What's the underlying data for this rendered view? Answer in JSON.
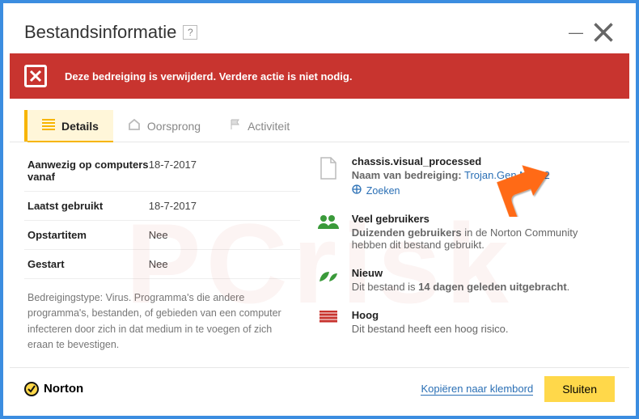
{
  "titlebar": {
    "title": "Bestandsinformatie"
  },
  "alert": {
    "text": "Deze bedreiging is verwijderd. Verdere actie is niet nodig."
  },
  "tabs": {
    "details": "Details",
    "origin": "Oorsprong",
    "activity": "Activiteit"
  },
  "rows": {
    "present_label": "Aanwezig op computers vanaf",
    "present_value": "18-7-2017",
    "lastused_label": "Laatst gebruikt",
    "lastused_value": "18-7-2017",
    "startup_label": "Opstartitem",
    "startup_value": "Nee",
    "started_label": "Gestart",
    "started_value": "Nee"
  },
  "description": "Bedreigingstype: Virus. Programma's die andere programma's, bestanden, of gebieden van een computer infecteren door zich in dat medium in te voegen of zich eraan te bevestigen.",
  "right": {
    "file_name": "chassis.visual_processed",
    "threat_label": "Naam van bedreiging:",
    "threat_name": "Trojan.Gen.NPE.2",
    "search": "Zoeken",
    "item2_h": "Veel gebruikers",
    "item2_s_pre": "Duizenden gebruikers",
    "item2_s_post": " in de Norton Community hebben dit bestand gebruikt.",
    "item3_h": "Nieuw",
    "item3_s_pre": "Dit bestand is ",
    "item3_s_bold": "14 dagen geleden uitgebracht",
    "item3_s_post": ".",
    "item4_h": "Hoog",
    "item4_s": "Dit bestand heeft een hoog risico."
  },
  "footer": {
    "brand": "Norton",
    "copy": "Kopiëren naar klembord",
    "close": "Sluiten"
  }
}
